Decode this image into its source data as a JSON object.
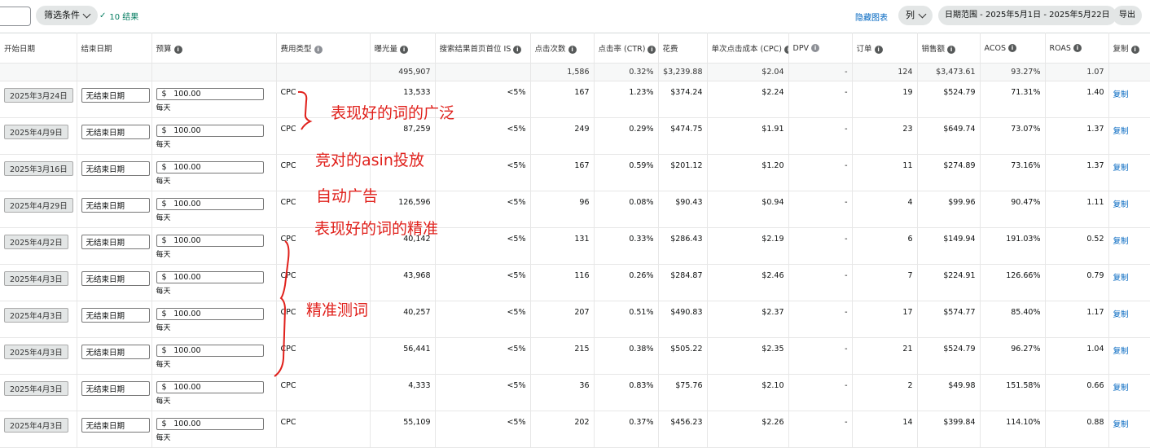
{
  "toolbar": {
    "filter_label": "筛选条件",
    "result_count": "10 结果",
    "hide_chart": "隐藏图表",
    "columns_label": "列",
    "date_range": "日期范围 - 2025年5月1日 - 2025年5月22日",
    "export_label": "导出"
  },
  "columns": [
    "开始日期",
    "结束日期",
    "预算",
    "费用类型",
    "曝光量",
    "搜索结果首页首位 IS",
    "点击次数",
    "点击率 (CTR)",
    "花费",
    "单次点击成本 (CPC)",
    "DPV",
    "订单",
    "销售额",
    "ACOS",
    "ROAS",
    "复制"
  ],
  "totals": {
    "impressions": "495,907",
    "clicks": "1,586",
    "ctr": "0.32%",
    "spend": "$3,239.88",
    "cpc": "$2.04",
    "dpv": "-",
    "orders": "124",
    "sales": "$3,473.61",
    "acos": "93.27%",
    "roas": "1.07"
  },
  "rows": [
    {
      "start": "2025年3月24日",
      "end": "无结束日期",
      "currency": "$",
      "budget": "100.00",
      "per": "每天",
      "type": "CPC",
      "impressions": "13,533",
      "tos": "<5%",
      "clicks": "167",
      "ctr": "1.23%",
      "spend": "$374.24",
      "cpc": "$2.24",
      "dpv": "-",
      "orders": "19",
      "sales": "$524.79",
      "acos": "71.31%",
      "roas": "1.40",
      "copy": "复制"
    },
    {
      "start": "2025年4月9日",
      "end": "无结束日期",
      "currency": "$",
      "budget": "100.00",
      "per": "每天",
      "type": "CPC",
      "impressions": "87,259",
      "tos": "<5%",
      "clicks": "249",
      "ctr": "0.29%",
      "spend": "$474.75",
      "cpc": "$1.91",
      "dpv": "-",
      "orders": "23",
      "sales": "$649.74",
      "acos": "73.07%",
      "roas": "1.37",
      "copy": "复制"
    },
    {
      "start": "2025年3月16日",
      "end": "无结束日期",
      "currency": "$",
      "budget": "100.00",
      "per": "每天",
      "type": "CPC",
      "impressions": "",
      "tos": "<5%",
      "clicks": "167",
      "ctr": "0.59%",
      "spend": "$201.12",
      "cpc": "$1.20",
      "dpv": "-",
      "orders": "11",
      "sales": "$274.89",
      "acos": "73.16%",
      "roas": "1.37",
      "copy": "复制"
    },
    {
      "start": "2025年4月29日",
      "end": "无结束日期",
      "currency": "$",
      "budget": "100.00",
      "per": "每天",
      "type": "CPC",
      "impressions": "126,596",
      "tos": "<5%",
      "clicks": "96",
      "ctr": "0.08%",
      "spend": "$90.43",
      "cpc": "$0.94",
      "dpv": "-",
      "orders": "4",
      "sales": "$99.96",
      "acos": "90.47%",
      "roas": "1.11",
      "copy": "复制"
    },
    {
      "start": "2025年4月2日",
      "end": "无结束日期",
      "currency": "$",
      "budget": "100.00",
      "per": "每天",
      "type": "CPC",
      "impressions": "40,142",
      "tos": "<5%",
      "clicks": "131",
      "ctr": "0.33%",
      "spend": "$286.43",
      "cpc": "$2.19",
      "dpv": "-",
      "orders": "6",
      "sales": "$149.94",
      "acos": "191.03%",
      "roas": "0.52",
      "copy": "复制"
    },
    {
      "start": "2025年4月3日",
      "end": "无结束日期",
      "currency": "$",
      "budget": "100.00",
      "per": "每天",
      "type": "CPC",
      "impressions": "43,968",
      "tos": "<5%",
      "clicks": "116",
      "ctr": "0.26%",
      "spend": "$284.87",
      "cpc": "$2.46",
      "dpv": "-",
      "orders": "7",
      "sales": "$224.91",
      "acos": "126.66%",
      "roas": "0.79",
      "copy": "复制"
    },
    {
      "start": "2025年4月3日",
      "end": "无结束日期",
      "currency": "$",
      "budget": "100.00",
      "per": "每天",
      "type": "CPC",
      "impressions": "40,257",
      "tos": "<5%",
      "clicks": "207",
      "ctr": "0.51%",
      "spend": "$490.83",
      "cpc": "$2.37",
      "dpv": "-",
      "orders": "17",
      "sales": "$574.77",
      "acos": "85.40%",
      "roas": "1.17",
      "copy": "复制"
    },
    {
      "start": "2025年4月3日",
      "end": "无结束日期",
      "currency": "$",
      "budget": "100.00",
      "per": "每天",
      "type": "CPC",
      "impressions": "56,441",
      "tos": "<5%",
      "clicks": "215",
      "ctr": "0.38%",
      "spend": "$505.22",
      "cpc": "$2.35",
      "dpv": "-",
      "orders": "21",
      "sales": "$524.79",
      "acos": "96.27%",
      "roas": "1.04",
      "copy": "复制"
    },
    {
      "start": "2025年4月3日",
      "end": "无结束日期",
      "currency": "$",
      "budget": "100.00",
      "per": "每天",
      "type": "CPC",
      "impressions": "4,333",
      "tos": "<5%",
      "clicks": "36",
      "ctr": "0.83%",
      "spend": "$75.76",
      "cpc": "$2.10",
      "dpv": "-",
      "orders": "2",
      "sales": "$49.98",
      "acos": "151.58%",
      "roas": "0.66",
      "copy": "复制"
    },
    {
      "start": "2025年4月3日",
      "end": "无结束日期",
      "currency": "$",
      "budget": "100.00",
      "per": "每天",
      "type": "CPC",
      "impressions": "55,109",
      "tos": "<5%",
      "clicks": "202",
      "ctr": "0.37%",
      "spend": "$456.23",
      "cpc": "$2.26",
      "dpv": "-",
      "orders": "14",
      "sales": "$399.84",
      "acos": "114.10%",
      "roas": "0.88",
      "copy": "复制"
    }
  ],
  "annotations": {
    "broad": "表现好的词的广泛",
    "asin": "竞对的asin投放",
    "auto": "自动广告",
    "exact": "表现好的词的精准",
    "test": "精准测词"
  },
  "colors": {
    "annotation": "#e0201b",
    "link": "#0066c0",
    "success": "#067d62"
  }
}
